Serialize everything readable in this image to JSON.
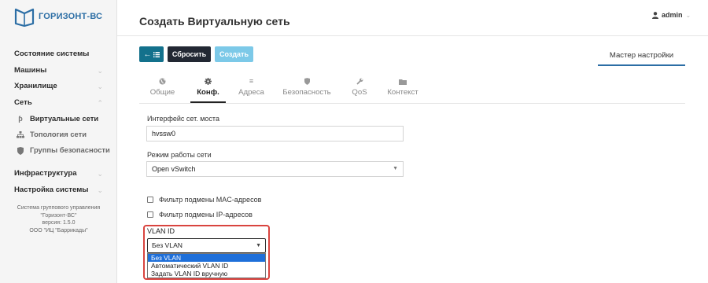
{
  "app": {
    "logo_text": "ГОРИЗОНТ-ВС",
    "brand_color": "#2c6ea5"
  },
  "sidebar": {
    "items": [
      {
        "label": "Состояние системы",
        "chevron": false
      },
      {
        "label": "Машины",
        "chevron": true
      },
      {
        "label": "Хранилище",
        "chevron": true
      },
      {
        "label": "Сеть",
        "chevron": true,
        "expanded": true
      }
    ],
    "network_subitems": [
      {
        "label": "Виртуальные сети",
        "icon": "route-icon",
        "active": true
      },
      {
        "label": "Топология сети",
        "icon": "sitemap-icon",
        "active": false
      },
      {
        "label": "Группы безопасности",
        "icon": "shield-icon",
        "active": false
      }
    ],
    "items2": [
      {
        "label": "Инфраструктура",
        "chevron": true
      },
      {
        "label": "Настройка системы",
        "chevron": true
      }
    ],
    "info": {
      "line1": "Система группового управления",
      "line2": "\"Горизонт-ВС\"",
      "line3": "версия: 1.5.0",
      "line4": "ООО \"ИЦ \"Баррикады\""
    }
  },
  "header": {
    "title": "Создать Виртуальную сеть",
    "user": "admin"
  },
  "toolbar": {
    "reset_label": "Сбросить",
    "create_label": "Создать",
    "wizard_label": "Мастер настройки"
  },
  "tabs": [
    {
      "label": "Общие",
      "icon": "globe-icon",
      "active": false
    },
    {
      "label": "Конф.",
      "icon": "gear-icon",
      "active": true
    },
    {
      "label": "Адреса",
      "icon": "list-icon",
      "active": false
    },
    {
      "label": "Безопасность",
      "icon": "shield-icon",
      "active": false
    },
    {
      "label": "QoS",
      "icon": "wrench-icon",
      "active": false
    },
    {
      "label": "Контекст",
      "icon": "folder-icon",
      "active": false
    }
  ],
  "form": {
    "bridge": {
      "label": "Интерфейс сет. моста",
      "value": "hvssw0"
    },
    "mode": {
      "label": "Режим работы сети",
      "value": "Open vSwitch"
    },
    "mac_filter": {
      "label": "Фильтр подмены MAC-адресов",
      "checked": false
    },
    "ip_filter": {
      "label": "Фильтр подмены IP-адресов",
      "checked": false
    },
    "vlan": {
      "label": "VLAN ID",
      "value": "Без VLAN",
      "options": [
        "Без VLAN",
        "Автоматический VLAN ID",
        "Задать VLAN ID вручную"
      ],
      "selected_index": 0,
      "highlight_color": "#d9443f"
    }
  }
}
